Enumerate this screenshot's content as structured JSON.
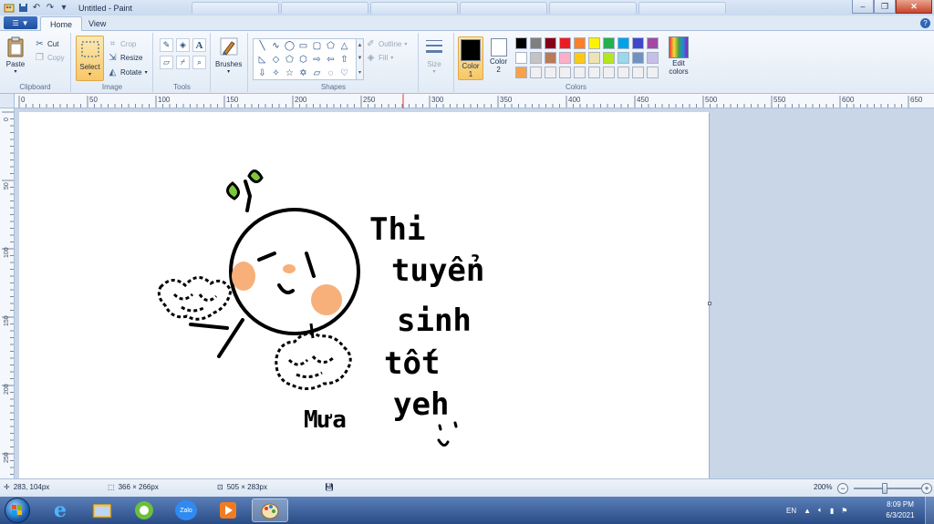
{
  "window": {
    "title": "Untitled - Paint",
    "minimize_glyph": "–",
    "restore_glyph": "❐",
    "close_glyph": "✕"
  },
  "ribbon_tabs": {
    "file_glyph": "▼",
    "home": "Home",
    "view": "View",
    "help_glyph": "?"
  },
  "clipboard": {
    "paste": "Paste",
    "cut": "Cut",
    "copy": "Copy",
    "group": "Clipboard"
  },
  "image": {
    "select": "Select",
    "crop": "Crop",
    "resize": "Resize",
    "rotate": "Rotate",
    "group": "Image"
  },
  "tools": {
    "group": "Tools",
    "text_tool": "A"
  },
  "brushes": {
    "label": "Brushes"
  },
  "shapes": {
    "outline": "Outline",
    "fill": "Fill",
    "group": "Shapes"
  },
  "size": {
    "label": "Size"
  },
  "colors": {
    "color1_label": "Color",
    "color1_num": "1",
    "color2_label": "Color",
    "color2_num": "2",
    "edit_label": "Edit",
    "edit_label2": "colors",
    "group": "Colors",
    "color1": "#000000",
    "color2": "#ffffff",
    "palette": [
      "#000000",
      "#7f7f7f",
      "#880015",
      "#ed1c24",
      "#ff7f27",
      "#fff200",
      "#22b14c",
      "#00a2e8",
      "#3f48cc",
      "#a349a4",
      "#ffffff",
      "#c3c3c3",
      "#b97a57",
      "#ffaec9",
      "#ffc90e",
      "#efe4b0",
      "#b5e61d",
      "#99d9ea",
      "#7092be",
      "#c8bfe7",
      "#f7a14d",
      "#f0f0f0",
      "#f0f0f0",
      "#f0f0f0",
      "#f0f0f0",
      "#f0f0f0",
      "#f0f0f0",
      "#f0f0f0",
      "#f0f0f0",
      "#f0f0f0"
    ]
  },
  "ruler": {
    "h_labels": [
      "0",
      "50",
      "100",
      "150",
      "200",
      "250",
      "300",
      "350",
      "400",
      "450",
      "500",
      "550",
      "600",
      "650"
    ],
    "v_labels": [
      "0",
      "50",
      "100",
      "150",
      "200",
      "250"
    ]
  },
  "drawing": {
    "text_line1": "Thi",
    "text_line2": "tuyển",
    "text_line3": "sinh",
    "text_line4": "tốt",
    "text_line5": "yeh",
    "signature": "Mưa"
  },
  "status": {
    "cursor_pos": "283, 104px",
    "selection_size": "366 × 266px",
    "image_size": "505 × 283px",
    "zoom": "200%"
  },
  "taskbar": {
    "language": "EN",
    "time": "8:09 PM",
    "date": "6/3/2021",
    "zalo_label": "Zalo"
  }
}
